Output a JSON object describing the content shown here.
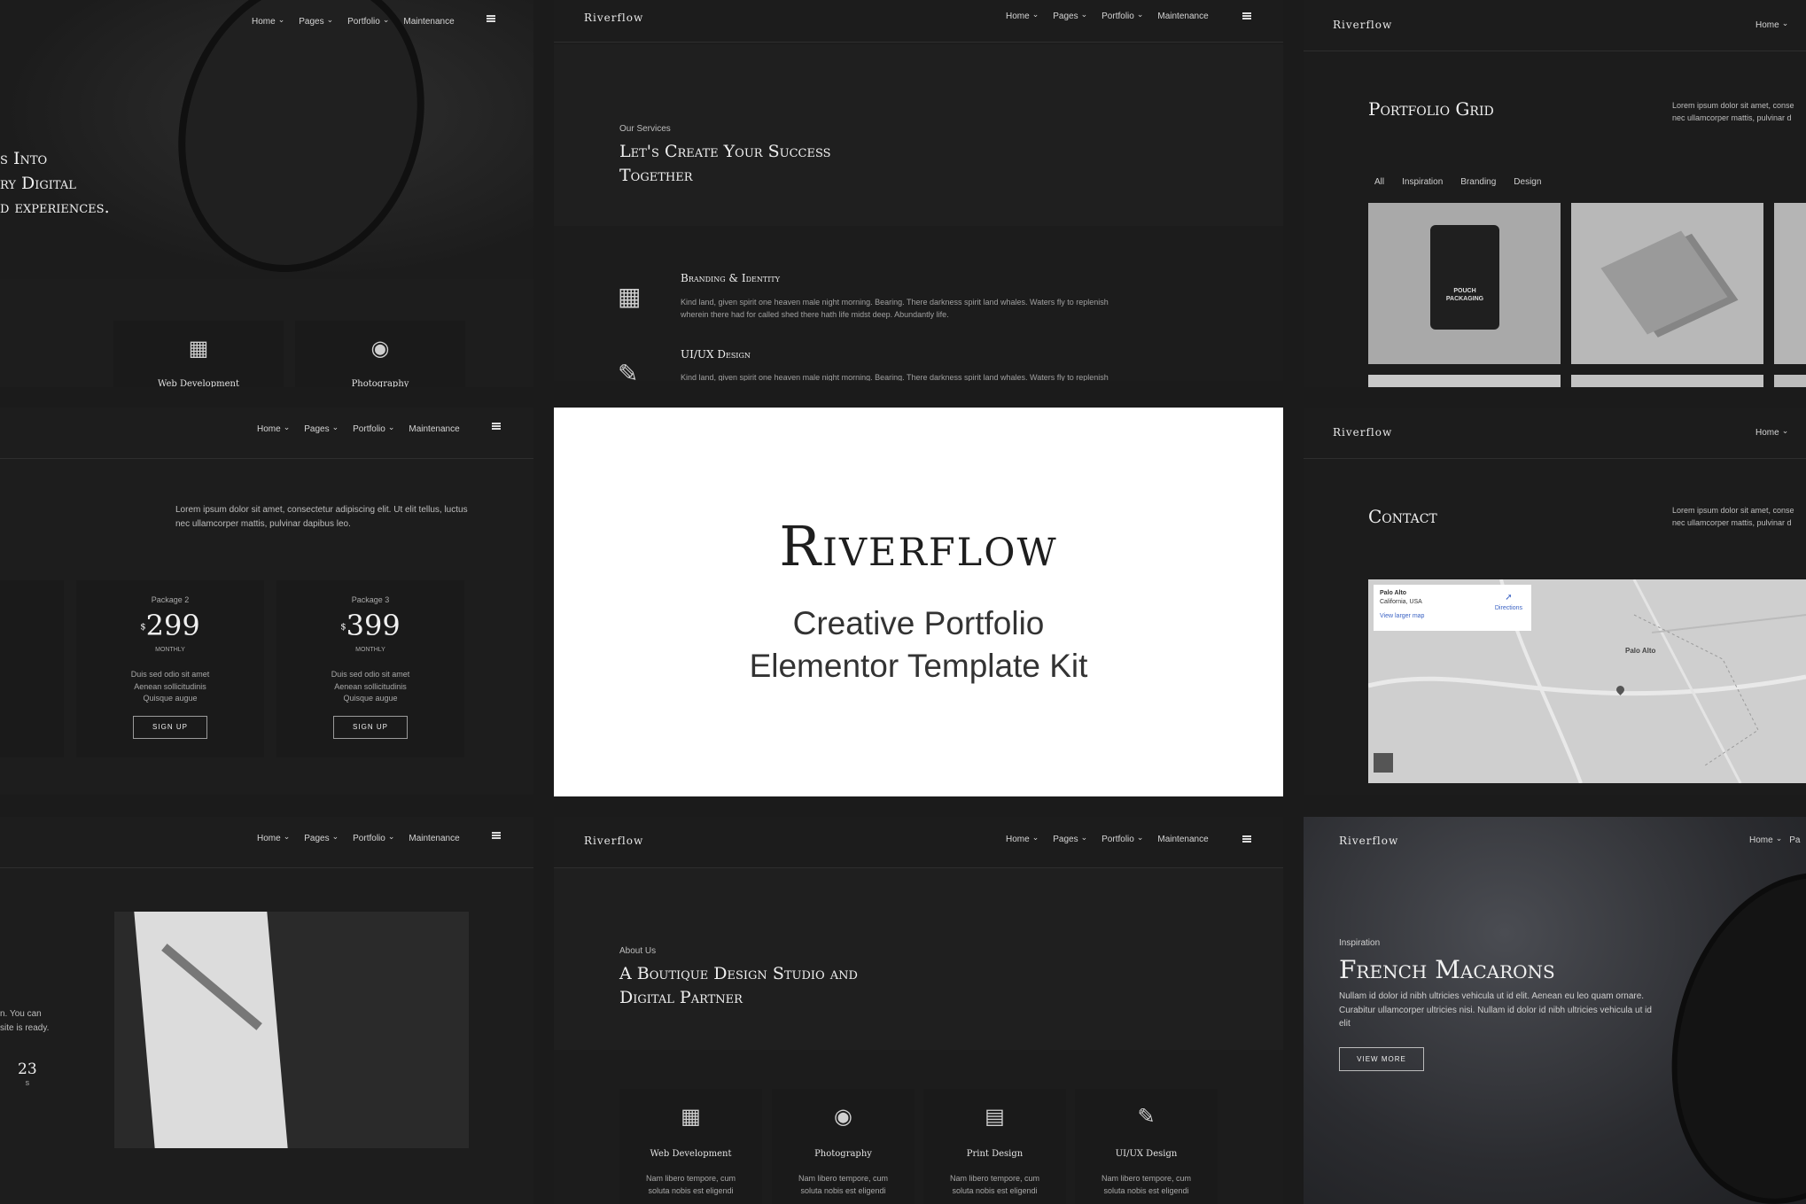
{
  "nav": {
    "home": "Home",
    "pages": "Pages",
    "portfolio": "Portfolio",
    "maintenance": "Maintenance"
  },
  "brand": "Riverflow",
  "center": {
    "title": "Riverflow",
    "line1": "Creative Portfolio",
    "line2": "Elementor Template Kit"
  },
  "tile1": {
    "heading": [
      "s Into",
      "ry Digital",
      "d experiences."
    ],
    "cards": [
      "Web Development",
      "Photography"
    ]
  },
  "tile2": {
    "eyebrow": "Our Services",
    "heading": [
      "Let's Create Your Success",
      "Together"
    ],
    "service1": {
      "title": "Branding & Identity",
      "text1": "Kind land, given spirit one heaven male night morning. Bearing. There darkness spirit land whales. Waters fly to replenish",
      "text2": "wherein there had for called shed there hath life midst deep. Abundantly life."
    },
    "service2": {
      "title": "UI/UX Design",
      "text1": "Kind land, given spirit one heaven male night morning. Bearing. There darkness spirit land whales. Waters fly to replenish"
    }
  },
  "tile3": {
    "title": "Portfolio Grid",
    "text": [
      "Lorem ipsum dolor sit amet, conse",
      "nec ullamcorper mattis, pulvinar d"
    ],
    "filters": [
      "All",
      "Inspiration",
      "Branding",
      "Design"
    ],
    "pouch": [
      "POUCH",
      "PACKAGING"
    ]
  },
  "tile4": {
    "text": [
      "Lorem ipsum dolor sit amet, consectetur adipiscing elit. Ut elit tellus, luctus",
      "nec ullamcorper mattis, pulvinar dapibus leo."
    ],
    "packages": [
      {
        "name": "Package 2",
        "currency": "$",
        "price": "299",
        "period": "Monthly",
        "features": [
          "Duis sed odio sit amet",
          "Aenean sollicitudinis",
          "Quisque augue"
        ],
        "button": "Sign Up"
      },
      {
        "name": "Package 3",
        "currency": "$",
        "price": "399",
        "period": "Monthly",
        "features": [
          "Duis sed odio sit amet",
          "Aenean sollicitudinis",
          "Quisque augue"
        ],
        "button": "Sign Up"
      }
    ]
  },
  "tile6": {
    "title": "Contact",
    "text": [
      "Lorem ipsum dolor sit amet, conse",
      "nec ullamcorper mattis, pulvinar d"
    ],
    "map": {
      "place": "Palo Alto",
      "region": "California, USA",
      "directions": "Directions",
      "larger": "View larger map",
      "label": "Palo Alto"
    }
  },
  "tile7": {
    "text": [
      "n. You can",
      "site is ready."
    ],
    "count": "23",
    "unit": "s"
  },
  "tile8": {
    "eyebrow": "About Us",
    "heading": [
      "A Boutique Design Studio and",
      "Digital Partner"
    ],
    "cards": [
      {
        "title": "Web Development",
        "text": [
          "Nam libero tempore, cum",
          "soluta nobis est eligendi"
        ]
      },
      {
        "title": "Photography",
        "text": [
          "Nam libero tempore, cum",
          "soluta nobis est eligendi"
        ]
      },
      {
        "title": "Print Design",
        "text": [
          "Nam libero tempore, cum",
          "soluta nobis est eligendi"
        ]
      },
      {
        "title": "UI/UX Design",
        "text": [
          "Nam libero tempore, cum",
          "soluta nobis est eligendi"
        ]
      }
    ]
  },
  "tile9": {
    "eyebrow": "Inspiration",
    "title": "French Macarons",
    "text": [
      "Nullam id dolor id nibh ultricies vehicula ut id elit. Aenean eu leo quam ornare.",
      "Curabitur ullamcorper ultricies nisi. Nullam id dolor id nibh ultricies vehicula ut id",
      "elit"
    ],
    "button": "View More",
    "nav_home": "Home",
    "nav_more": "Pa"
  }
}
